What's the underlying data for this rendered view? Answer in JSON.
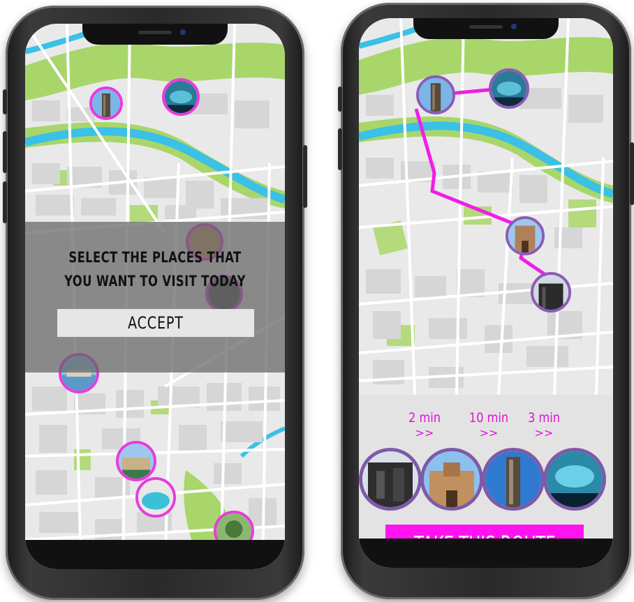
{
  "left_screen": {
    "prompt_line1": "SELECT THE PLACES THAT",
    "prompt_line2": "YOU WANT TO VISIT TODAY",
    "accept_label": "ACCEPT"
  },
  "right_screen": {
    "segments": [
      {
        "time": "2 min",
        "arrow": ">>"
      },
      {
        "time": "10 min",
        "arrow": ">>"
      },
      {
        "time": "3 min",
        "arrow": ">>"
      }
    ],
    "take_route_label": "TAKE THIS ROUTE"
  },
  "colors": {
    "accent_pink": "#ff14f0",
    "poi_border_pink": "#e63cde",
    "poi_border_purple": "#8a5cb6",
    "route_line": "#f01ee8",
    "map_park": "#a8d66a",
    "map_water": "#3bc0e6",
    "map_road": "#ffffff",
    "map_block": "#d6d6d6"
  },
  "icons": [
    "tower-photo-icon",
    "aquarium-photo-icon",
    "tower-gate-photo-icon",
    "modern-building-photo-icon",
    "lake-photo-icon",
    "palace-photo-icon",
    "garden-photo-icon"
  ]
}
